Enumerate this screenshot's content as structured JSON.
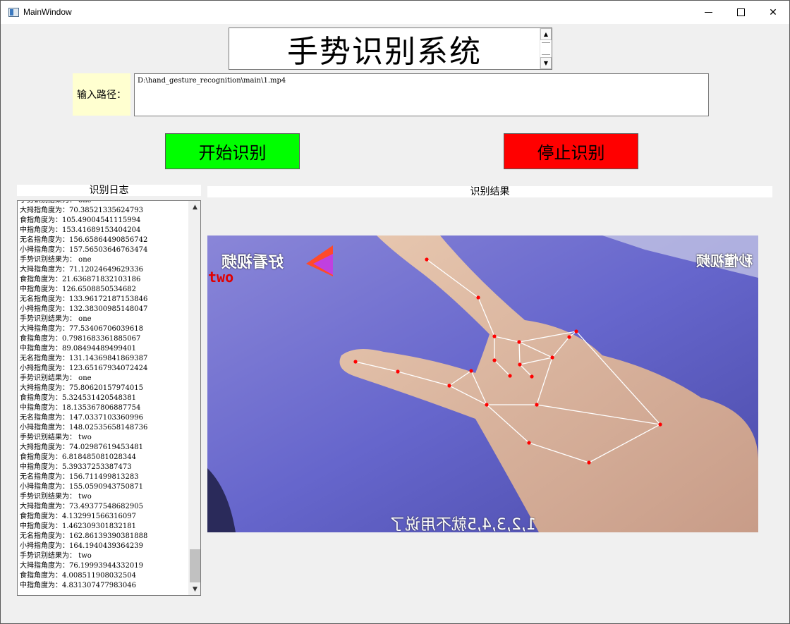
{
  "window": {
    "title": "MainWindow",
    "minimize": "minimize",
    "maximize": "maximize",
    "close": "✕"
  },
  "header": {
    "title": "手势识别系统"
  },
  "input": {
    "label": "输入路径：",
    "value": "D:\\hand_gesture_recognition\\main\\1.mp4"
  },
  "buttons": {
    "start": "开始识别",
    "stop": "停止识别",
    "start_color": "#00ff00",
    "stop_color": "#ff0000"
  },
  "log": {
    "title": "识别日志",
    "lines": [
      "手势识别结果为： one",
      "大拇指角度为：70.38521335624793",
      "食指角度为：105.49004541115994",
      "中指角度为：153.41689153404204",
      "无名指角度为：156.65864490856742",
      "小拇指角度为：157.56503646763474",
      "手势识别结果为： one",
      "大拇指角度为：71.12024649629336",
      "食指角度为：21.636871832103186",
      "中指角度为：126.6508850534682",
      "无名指角度为：133.96172187153846",
      "小拇指角度为：132.38300985148047",
      "手势识别结果为： one",
      "大拇指角度为：77.53406706039618",
      "食指角度为：0.7981683361885067",
      "中指角度为：89.08494489499401",
      "无名指角度为：131.14369841869387",
      "小拇指角度为：123.65167934072424",
      "手势识别结果为： one",
      "大拇指角度为：75.80620157974015",
      "食指角度为：5.324531420548381",
      "中指角度为：18.135367806887754",
      "无名指角度为：147.0337103360996",
      "小拇指角度为：148.02535658148736",
      "手势识别结果为： two",
      "大拇指角度为：74.02987619453481",
      "食指角度为：6.818485081028344",
      "中指角度为：5.39337253387473",
      "无名指角度为：156.711499813283",
      "小拇指角度为：155.0590943750871",
      "手势识别结果为： two",
      "大拇指角度为：73.49377548682905",
      "食指角度为：4.132991566316097",
      "中指角度为：1.462309301832181",
      "无名指角度为：162.86139390381888",
      "小拇指角度为：164.1940439364239",
      "手势识别结果为： two",
      "大拇指角度为：76.19993944332019",
      "食指角度为：4.008511908032504",
      "中指角度为：4.831307477983046"
    ]
  },
  "result": {
    "title": "识别结果",
    "gesture_label": "two",
    "watermark_left": "好看视频",
    "watermark_right": "秒懂视频",
    "subtitle": "1,2,3,4,5就不用说了",
    "skeleton_color": "#ffffff",
    "joint_color": "#ff0000"
  }
}
